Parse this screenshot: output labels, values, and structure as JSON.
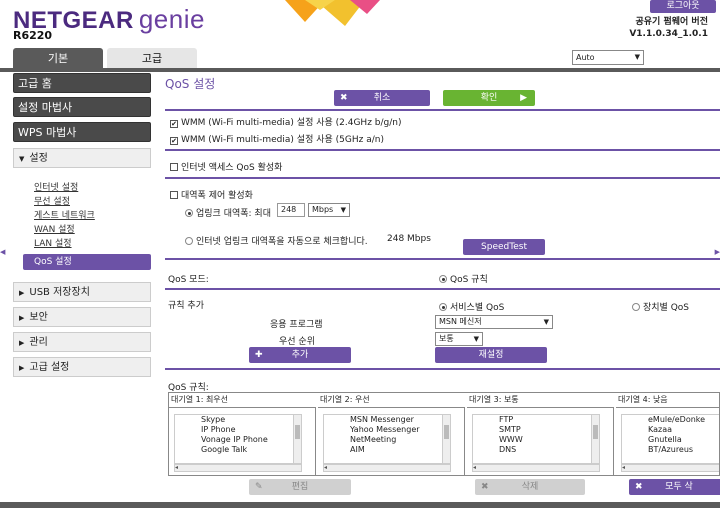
{
  "brand": {
    "name": "NETGEAR",
    "product": "genie",
    "model": "R6220"
  },
  "header": {
    "logout": "로그아웃",
    "fw_label": "공유기 펌웨어 버전",
    "fw_version": "V1.1.0.34_1.0.1",
    "language": "Auto"
  },
  "tabs": {
    "basic": "기본",
    "advanced": "고급"
  },
  "sidebar": {
    "home": "고급 홈",
    "wizard": "설정 마법사",
    "wps": "WPS 마법사",
    "setup_group": "설정",
    "items": [
      "인터넷 설정",
      "무선 설정",
      "게스트 네트워크",
      "WAN 설정",
      "LAN 설정",
      "QoS 설정"
    ],
    "usb": "USB 저장장치",
    "security": "보안",
    "admin": "관리",
    "advanced_setup": "고급 설정"
  },
  "main": {
    "title": "QoS 설정",
    "cancel": "취소",
    "apply": "확인",
    "wmm24": "WMM (Wi-Fi multi-media) 설정 사용 (2.4GHz b/g/n)",
    "wmm5": "WMM (Wi-Fi multi-media) 설정 사용 (5GHz a/n)",
    "internet_qos": "인터넷 액세스 QoS 활성화",
    "bw_control": "대역폭 제어 활성화",
    "uplink_manual": "업링크 대역폭: 최대",
    "uplink_value": "248",
    "uplink_unit": "Mbps",
    "uplink_auto": "인터넷 업링크 대역폭을 자동으로 체크합니다.",
    "uplink_auto_value": "248 Mbps",
    "speedtest": "SpeedTest",
    "qos_mode_label": "QoS 모드:",
    "qos_mode_value": "QoS 규칙",
    "add_rule_label": "규칙 추가",
    "by_service": "서비스별 QoS",
    "by_device": "장치별 QoS",
    "app_label": "응용 프로그램",
    "app_value": "MSN 메신저",
    "priority_label": "우선 순위",
    "priority_value": "보통",
    "add": "추가",
    "reset": "재설정",
    "rules_label": "QoS 규칙:",
    "edit": "편집",
    "delete": "삭제",
    "delete_all": "모두 삭"
  },
  "queues": [
    {
      "header": "대기열 1: 최우선",
      "items": [
        "Skype",
        "IP Phone",
        "Vonage IP Phone",
        "Google Talk"
      ]
    },
    {
      "header": "대기열 2: 우선",
      "items": [
        "MSN Messenger",
        "Yahoo Messenger",
        "NetMeeting",
        "AIM"
      ]
    },
    {
      "header": "대기열 3: 보통",
      "items": [
        "FTP",
        "SMTP",
        "WWW",
        "DNS"
      ]
    },
    {
      "header": "대기열 4: 낮음",
      "items": [
        "eMule/eDonke",
        "Kazaa",
        "Gnutella",
        "BT/Azureus"
      ]
    }
  ],
  "colors": {
    "accent": "#6c52a6",
    "ok": "#69b432",
    "dark": "#4a4a4a"
  }
}
